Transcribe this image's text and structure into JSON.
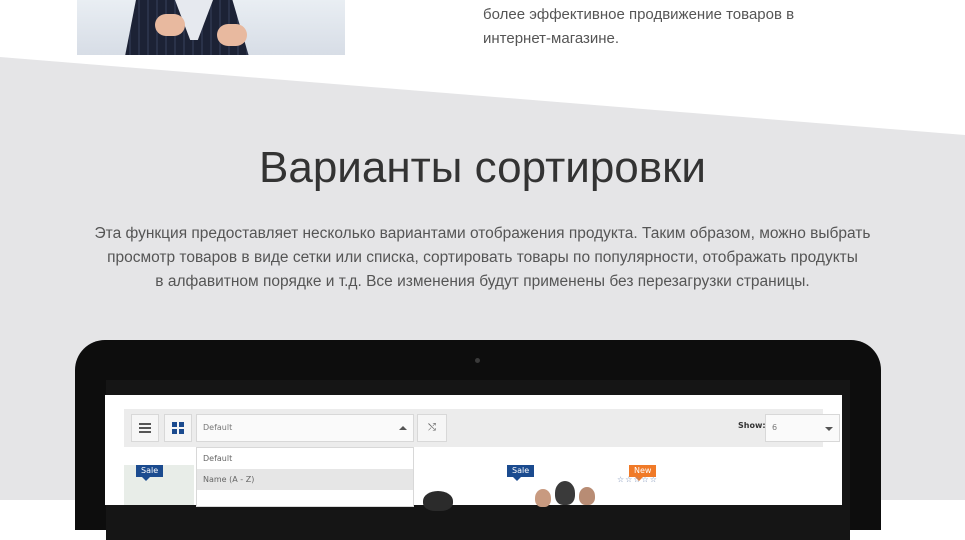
{
  "top": {
    "text_lines": [
      "более эффективное продвижение товаров в",
      "интернет-магазине."
    ]
  },
  "section": {
    "title": "Варианты сортировки",
    "description_lines": [
      "Эта функция предоставляет несколько вариантами отображения продукта. Таким образом, можно выбрать",
      "просмотр товаров в виде сетки или списка, сортировать товары по популярности, отображать продукты",
      "в алфавитном порядке и т.д. Все изменения будут применены без перезагрузки страницы."
    ]
  },
  "shop": {
    "sort_select_value": "Default",
    "direction_glyph": "⤭",
    "show_label": "Show:",
    "show_value": "6",
    "dropdown_options": [
      "Default",
      "Name (A - Z)"
    ],
    "badges": {
      "sale_1": "Sale",
      "sale_2": "Sale",
      "new_1": "New"
    },
    "stars": "☆☆☆☆☆"
  },
  "colors": {
    "band": "#e5e5e7",
    "sale_badge": "#1b4b8f",
    "new_badge": "#f07a28",
    "laptop_frame": "#0d0d0d"
  }
}
